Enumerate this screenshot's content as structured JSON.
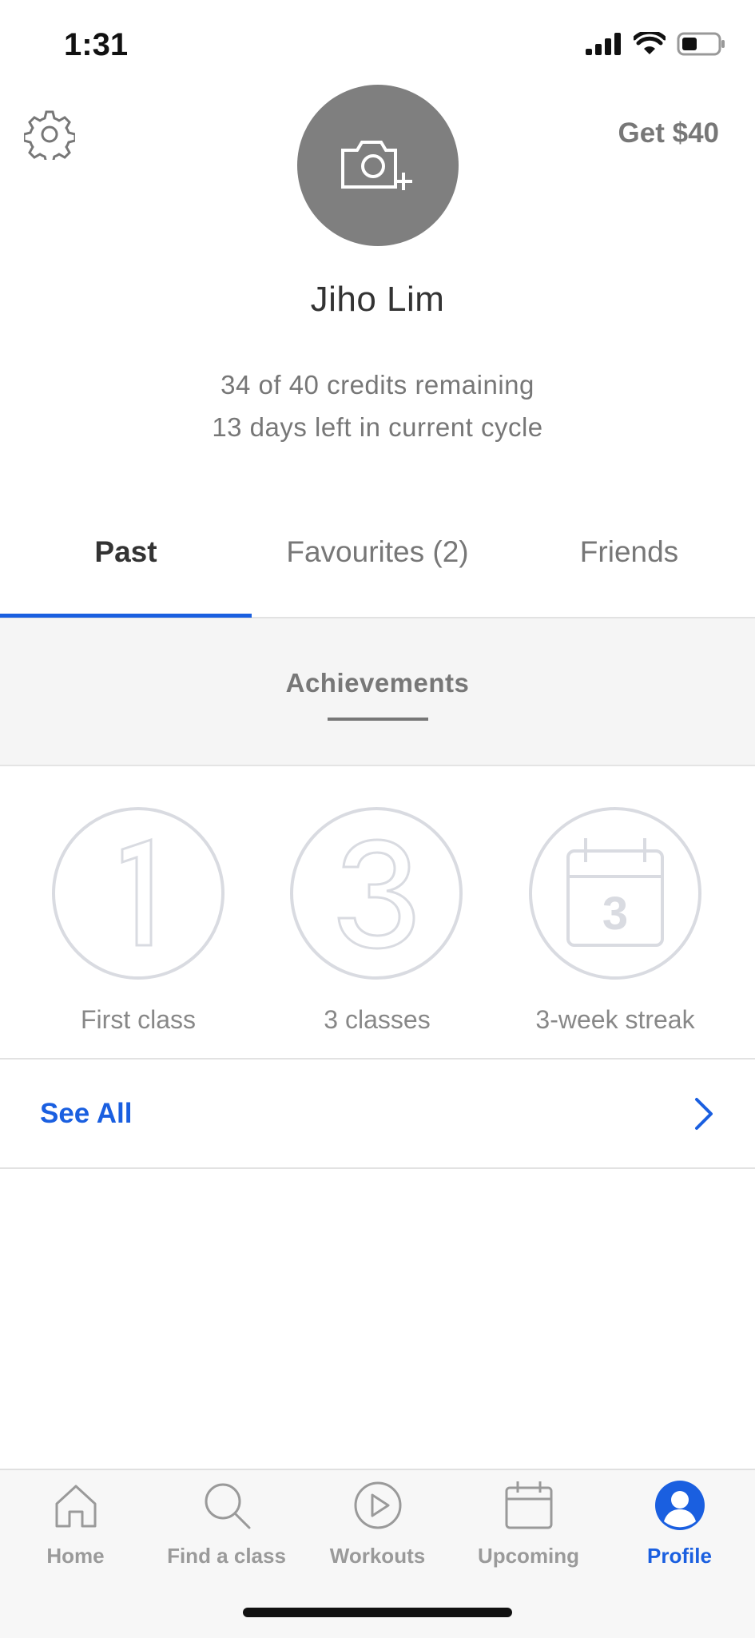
{
  "status_bar": {
    "time": "1:31"
  },
  "header": {
    "referral_label": "Get $40",
    "user_name": "Jiho Lim",
    "credits_text": "34 of 40 credits remaining",
    "cycle_text": "13 days left in current cycle"
  },
  "tabs": [
    {
      "label": "Past",
      "selected": true
    },
    {
      "label": "Favourites (2)",
      "selected": false
    },
    {
      "label": "Friends",
      "selected": false
    }
  ],
  "section": {
    "title": "Achievements"
  },
  "badges": [
    {
      "glyph": "1",
      "label": "First class"
    },
    {
      "glyph": "3",
      "label": "3 classes"
    },
    {
      "glyph": "3",
      "label": "3-week streak",
      "icon": "calendar-icon"
    }
  ],
  "see_all": {
    "label": "See All"
  },
  "bottom_nav": [
    {
      "label": "Home",
      "icon": "home-icon",
      "active": false
    },
    {
      "label": "Find a class",
      "icon": "search-icon",
      "active": false
    },
    {
      "label": "Workouts",
      "icon": "play-circle-icon",
      "active": false
    },
    {
      "label": "Upcoming",
      "icon": "calendar-icon",
      "active": false
    },
    {
      "label": "Profile",
      "icon": "profile-icon",
      "active": true
    }
  ],
  "colors": {
    "accent": "#1a5fe0",
    "avatar_bg": "#7f7f7f",
    "badge_outline": "#d9dbe1",
    "muted_text": "#777777"
  }
}
